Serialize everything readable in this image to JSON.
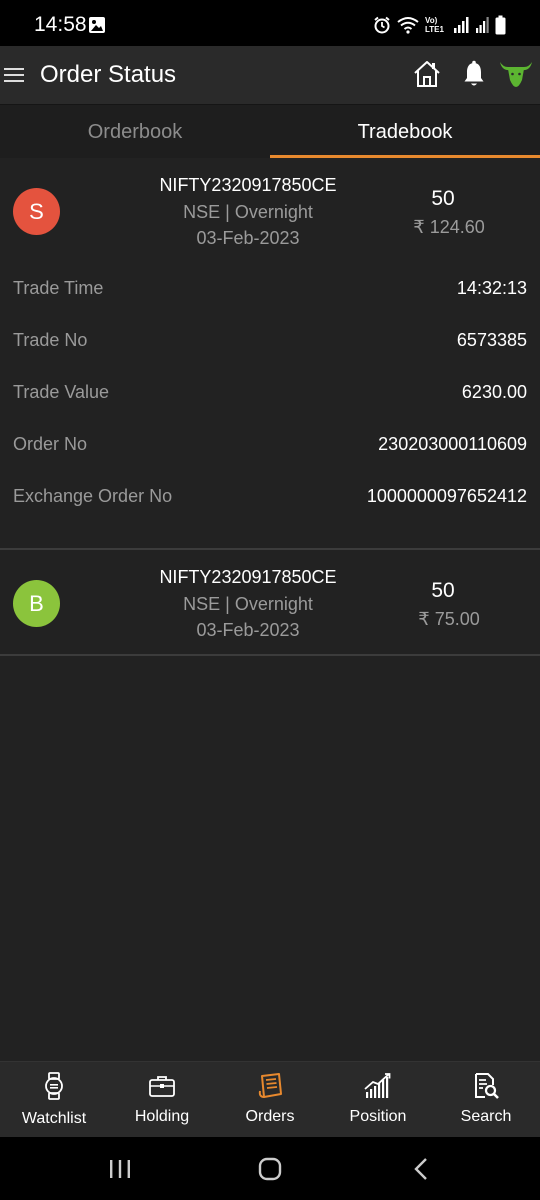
{
  "status_bar": {
    "time": "14:58",
    "icons": [
      "alarm-icon",
      "wifi-icon",
      "volte-icon",
      "signal-icon",
      "battery-icon"
    ],
    "network_label": "Vo) LTE1"
  },
  "header": {
    "title": "Order Status",
    "icons": [
      "menu-icon",
      "home-icon",
      "bell-icon",
      "bull-logo-icon"
    ]
  },
  "tabs": [
    {
      "label": "Orderbook",
      "active": false
    },
    {
      "label": "Tradebook",
      "active": true
    }
  ],
  "trades": [
    {
      "side_letter": "S",
      "symbol": "NIFTY2320917850CE",
      "exchange_product": "NSE | Overnight",
      "date": "03-Feb-2023",
      "quantity": "50",
      "price": "₹ 124.60",
      "expanded": true,
      "details": [
        {
          "label": "Trade Time",
          "value": "14:32:13"
        },
        {
          "label": "Trade No",
          "value": "6573385"
        },
        {
          "label": "Trade Value",
          "value": "6230.00"
        },
        {
          "label": "Order No",
          "value": "230203000110609"
        },
        {
          "label": "Exchange Order No",
          "value": "1000000097652412"
        }
      ]
    },
    {
      "side_letter": "B",
      "symbol": "NIFTY2320917850CE",
      "exchange_product": "NSE | Overnight",
      "date": "03-Feb-2023",
      "quantity": "50",
      "price": "₹ 75.00",
      "expanded": false
    }
  ],
  "bottom_nav": [
    {
      "label": "Watchlist",
      "icon": "watch-icon",
      "active": false
    },
    {
      "label": "Holding",
      "icon": "briefcase-icon",
      "active": false
    },
    {
      "label": "Orders",
      "icon": "orders-icon",
      "active": true
    },
    {
      "label": "Position",
      "icon": "position-chart-icon",
      "active": false
    },
    {
      "label": "Search",
      "icon": "search-doc-icon",
      "active": false
    }
  ],
  "colors": {
    "accent": "#e8892e",
    "sell": "#e4533e",
    "buy": "#8bc43c",
    "brand_green": "#5cb531",
    "header_bg": "#2a2a2a",
    "content_bg": "#222222"
  }
}
